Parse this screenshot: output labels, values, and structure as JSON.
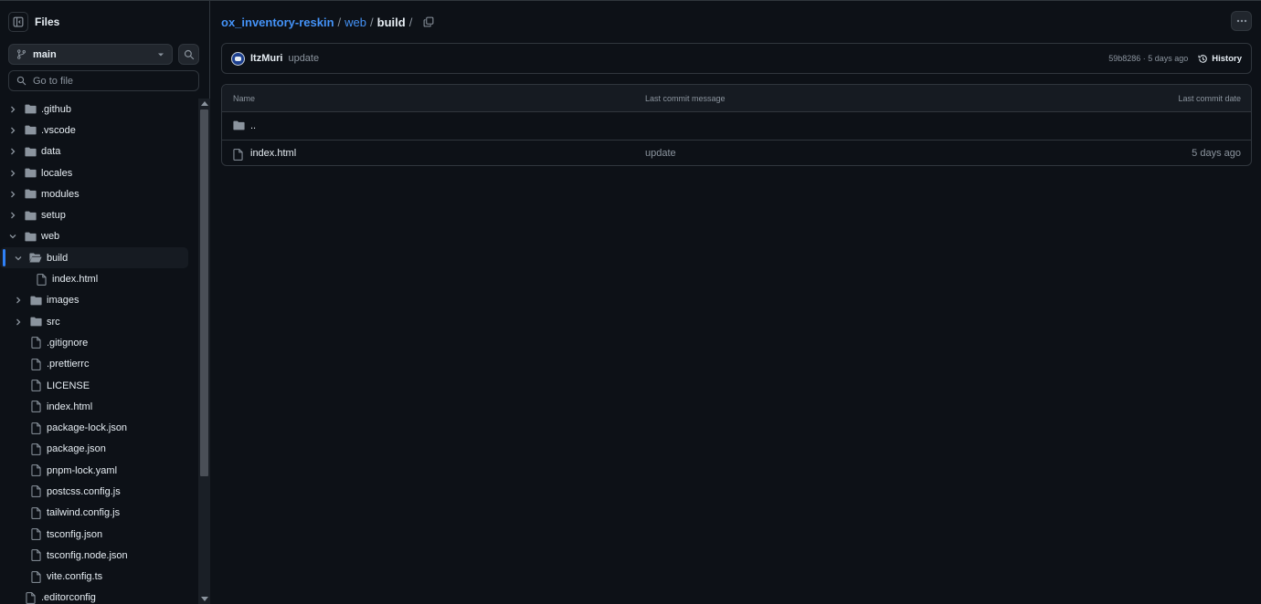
{
  "sidebar": {
    "title": "Files",
    "branch": "main",
    "goto_placeholder": "Go to file",
    "tree": [
      {
        "label": ".github",
        "type": "folder",
        "depth": 0,
        "chevron": "right"
      },
      {
        "label": ".vscode",
        "type": "folder",
        "depth": 0,
        "chevron": "right"
      },
      {
        "label": "data",
        "type": "folder",
        "depth": 0,
        "chevron": "right"
      },
      {
        "label": "locales",
        "type": "folder",
        "depth": 0,
        "chevron": "right"
      },
      {
        "label": "modules",
        "type": "folder",
        "depth": 0,
        "chevron": "right"
      },
      {
        "label": "setup",
        "type": "folder",
        "depth": 0,
        "chevron": "right"
      },
      {
        "label": "web",
        "type": "folder",
        "depth": 0,
        "chevron": "down"
      },
      {
        "label": "build",
        "type": "folder-open",
        "depth": 1,
        "chevron": "down",
        "active": true
      },
      {
        "label": "index.html",
        "type": "file",
        "depth": 2,
        "chevron": "none"
      },
      {
        "label": "images",
        "type": "folder",
        "depth": 1,
        "chevron": "right"
      },
      {
        "label": "src",
        "type": "folder",
        "depth": 1,
        "chevron": "right"
      },
      {
        "label": ".gitignore",
        "type": "file",
        "depth": 1,
        "chevron": "none"
      },
      {
        "label": ".prettierrc",
        "type": "file",
        "depth": 1,
        "chevron": "none"
      },
      {
        "label": "LICENSE",
        "type": "file",
        "depth": 1,
        "chevron": "none"
      },
      {
        "label": "index.html",
        "type": "file",
        "depth": 1,
        "chevron": "none"
      },
      {
        "label": "package-lock.json",
        "type": "file",
        "depth": 1,
        "chevron": "none"
      },
      {
        "label": "package.json",
        "type": "file",
        "depth": 1,
        "chevron": "none"
      },
      {
        "label": "pnpm-lock.yaml",
        "type": "file",
        "depth": 1,
        "chevron": "none"
      },
      {
        "label": "postcss.config.js",
        "type": "file",
        "depth": 1,
        "chevron": "none"
      },
      {
        "label": "tailwind.config.js",
        "type": "file",
        "depth": 1,
        "chevron": "none"
      },
      {
        "label": "tsconfig.json",
        "type": "file",
        "depth": 1,
        "chevron": "none"
      },
      {
        "label": "tsconfig.node.json",
        "type": "file",
        "depth": 1,
        "chevron": "none"
      },
      {
        "label": "vite.config.ts",
        "type": "file",
        "depth": 1,
        "chevron": "none"
      },
      {
        "label": ".editorconfig",
        "type": "file",
        "depth": 0,
        "chevron": "none"
      }
    ]
  },
  "breadcrumb": {
    "repo": "ox_inventory-reskin",
    "dir": "web",
    "current": "build",
    "sep": "/"
  },
  "commit": {
    "author": "ItzMuri",
    "message": "update",
    "hash_time": "59b8286 · 5 days ago",
    "history_label": "History"
  },
  "table": {
    "headers": {
      "name": "Name",
      "message": "Last commit message",
      "date": "Last commit date"
    },
    "parent_label": "..",
    "rows": [
      {
        "name": "index.html",
        "message": "update",
        "date": "5 days ago"
      }
    ]
  },
  "colors": {
    "background": "#0d1117",
    "border": "#30363d",
    "link": "#4493f8",
    "muted": "#8b949e",
    "accent": "#2f81f7"
  }
}
